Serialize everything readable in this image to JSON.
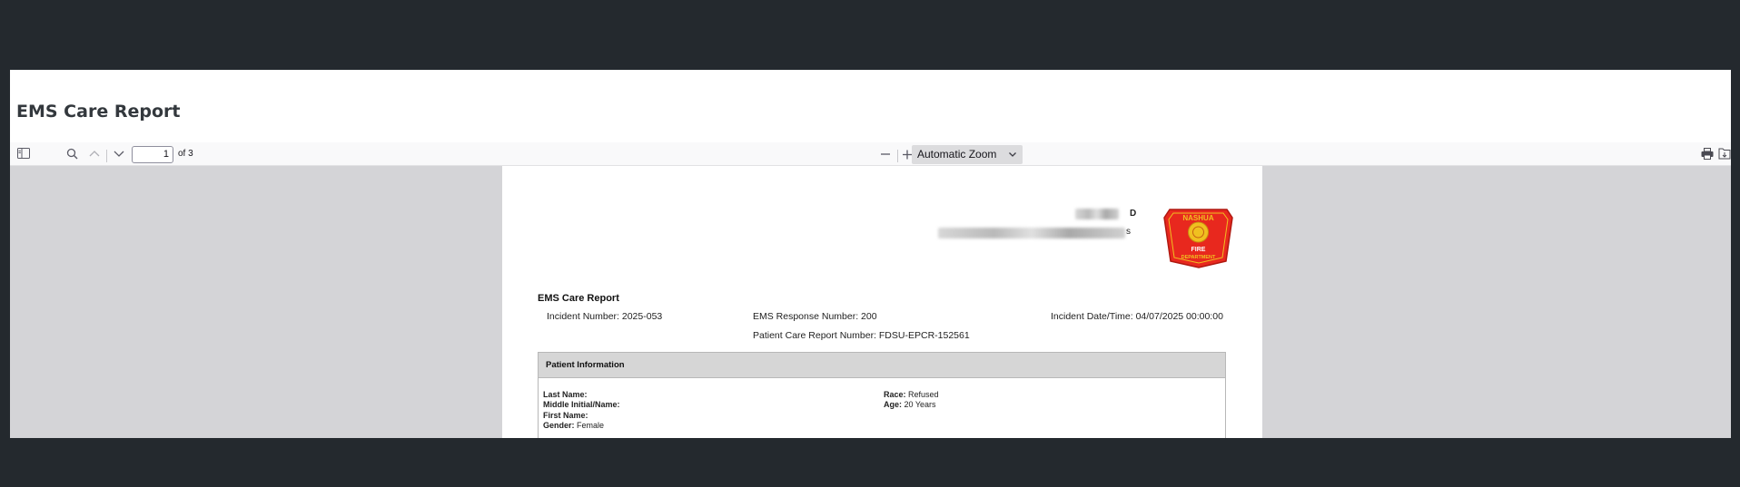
{
  "page": {
    "title": "EMS Care Report"
  },
  "toolbar": {
    "page_number": "1",
    "page_total": "of 3",
    "zoom_value": "Automatic Zoom"
  },
  "document": {
    "header_partial_1": "D",
    "header_partial_2": "s",
    "logo": {
      "top_text": "NASHUA",
      "fire": "FIRE",
      "dept": "DEPARTMENT",
      "colors": {
        "shield": "#e8281e",
        "gold": "#f0c020"
      }
    },
    "heading": "EMS Care Report",
    "incident_number": "Incident Number: 2025-053",
    "ems_response_number": "EMS Response Number: 200",
    "incident_datetime": "Incident Date/Time: 04/07/2025 00:00:00",
    "patient_care_report_number": "Patient Care Report Number: FDSU-EPCR-152561",
    "patient_info": {
      "section_title": "Patient Information",
      "last_name_label": "Last Name:",
      "middle_label": "Middle Initial/Name:",
      "first_name_label": "First Name:",
      "gender_label": "Gender:",
      "gender_value": "Female",
      "race_label": "Race:",
      "race_value": "Refused",
      "age_label": "Age:",
      "age_value": "20 Years"
    }
  }
}
